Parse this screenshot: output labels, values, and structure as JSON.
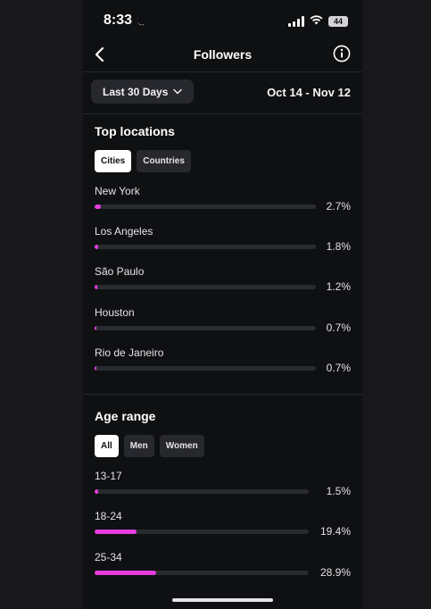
{
  "status_bar": {
    "time": "8:33",
    "battery": "44"
  },
  "header": {
    "title": "Followers"
  },
  "date_filter": {
    "label": "Last 30 Days",
    "range": "Oct 14 - Nov 12"
  },
  "top_locations": {
    "title": "Top locations",
    "tabs": [
      {
        "label": "Cities",
        "active": true
      },
      {
        "label": "Countries",
        "active": false
      }
    ],
    "items": [
      {
        "label": "New York",
        "value": "2.7%",
        "fraction": 0.027
      },
      {
        "label": "Los Angeles",
        "value": "1.8%",
        "fraction": 0.018
      },
      {
        "label": "São Paulo",
        "value": "1.2%",
        "fraction": 0.012
      },
      {
        "label": "Houston",
        "value": "0.7%",
        "fraction": 0.007
      },
      {
        "label": "Rio de Janeiro",
        "value": "0.7%",
        "fraction": 0.007
      }
    ]
  },
  "age_range": {
    "title": "Age range",
    "tabs": [
      {
        "label": "All",
        "active": true
      },
      {
        "label": "Men",
        "active": false
      },
      {
        "label": "Women",
        "active": false
      }
    ],
    "items": [
      {
        "label": "13-17",
        "value": "1.5%",
        "fraction": 0.015
      },
      {
        "label": "18-24",
        "value": "19.4%",
        "fraction": 0.194
      },
      {
        "label": "25-34",
        "value": "28.9%",
        "fraction": 0.289
      }
    ]
  },
  "colors": {
    "accent": "#e63ee0",
    "background": "#0f1012",
    "track": "#2a2b30"
  }
}
